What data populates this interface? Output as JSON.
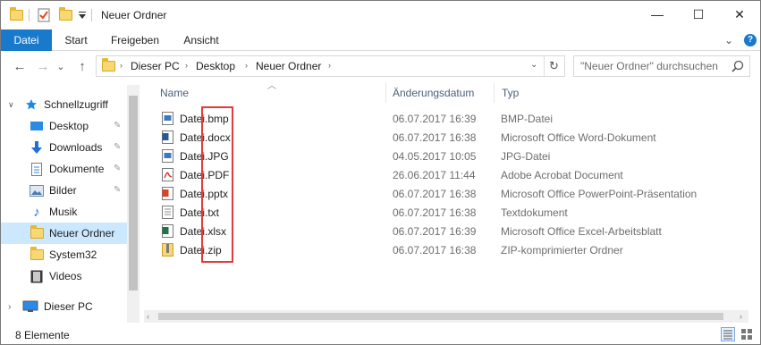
{
  "window": {
    "title": "Neuer Ordner",
    "minimize_glyph": "—",
    "maximize_glyph": "☐",
    "close_glyph": "✕"
  },
  "ribbon": {
    "tabs": [
      "Datei",
      "Start",
      "Freigeben",
      "Ansicht"
    ],
    "expand_glyph": "⌄",
    "help_glyph": "?"
  },
  "navigation": {
    "back_glyph": "←",
    "forward_glyph": "→",
    "recent_glyph": "⌄",
    "up_glyph": "↑",
    "refresh_glyph": "↻"
  },
  "address": {
    "breadcrumbs": [
      "Dieser PC",
      "Desktop",
      "Neuer Ordner"
    ]
  },
  "search": {
    "placeholder": "\"Neuer Ordner\" durchsuchen"
  },
  "sidebar": {
    "items": [
      {
        "label": "Schnellzugriff",
        "icon": "star-icon",
        "pinned": false
      },
      {
        "label": "Desktop",
        "icon": "desktop-icon",
        "pinned": true
      },
      {
        "label": "Downloads",
        "icon": "download-icon",
        "pinned": true
      },
      {
        "label": "Dokumente",
        "icon": "document-icon",
        "pinned": true
      },
      {
        "label": "Bilder",
        "icon": "pictures-icon",
        "pinned": true
      },
      {
        "label": "Musik",
        "icon": "music-icon",
        "pinned": false
      },
      {
        "label": "Neuer Ordner",
        "icon": "folder-icon",
        "pinned": false,
        "selected": true
      },
      {
        "label": "System32",
        "icon": "folder-icon",
        "pinned": false
      },
      {
        "label": "Videos",
        "icon": "video-icon",
        "pinned": false
      },
      {
        "label": "Dieser PC",
        "icon": "computer-icon",
        "pinned": false
      }
    ]
  },
  "columns": {
    "name": "Name",
    "date": "Änderungsdatum",
    "type": "Typ"
  },
  "files": [
    {
      "name": "Datei.bmp",
      "date": "06.07.2017 16:39",
      "type": "BMP-Datei",
      "icon": "bmp-file-icon"
    },
    {
      "name": "Datei.docx",
      "date": "06.07.2017 16:38",
      "type": "Microsoft Office Word-Dokument",
      "icon": "word-file-icon"
    },
    {
      "name": "Datei.JPG",
      "date": "04.05.2017 10:05",
      "type": "JPG-Datei",
      "icon": "jpg-file-icon"
    },
    {
      "name": "Datei.PDF",
      "date": "26.06.2017 11:44",
      "type": "Adobe Acrobat Document",
      "icon": "pdf-file-icon"
    },
    {
      "name": "Datei.pptx",
      "date": "06.07.2017 16:38",
      "type": "Microsoft Office PowerPoint-Präsentation",
      "icon": "powerpoint-file-icon"
    },
    {
      "name": "Datei.txt",
      "date": "06.07.2017 16:38",
      "type": "Textdokument",
      "icon": "text-file-icon"
    },
    {
      "name": "Datei.xlsx",
      "date": "06.07.2017 16:39",
      "type": "Microsoft Office Excel-Arbeitsblatt",
      "icon": "excel-file-icon"
    },
    {
      "name": "Datei.zip",
      "date": "06.07.2017 16:38",
      "type": "ZIP-komprimierter Ordner",
      "icon": "zip-file-icon"
    }
  ],
  "status": {
    "item_count": "8 Elemente"
  },
  "colors": {
    "accent": "#1979ca",
    "selection": "#cce8ff",
    "highlight_border": "#e03c3c"
  }
}
